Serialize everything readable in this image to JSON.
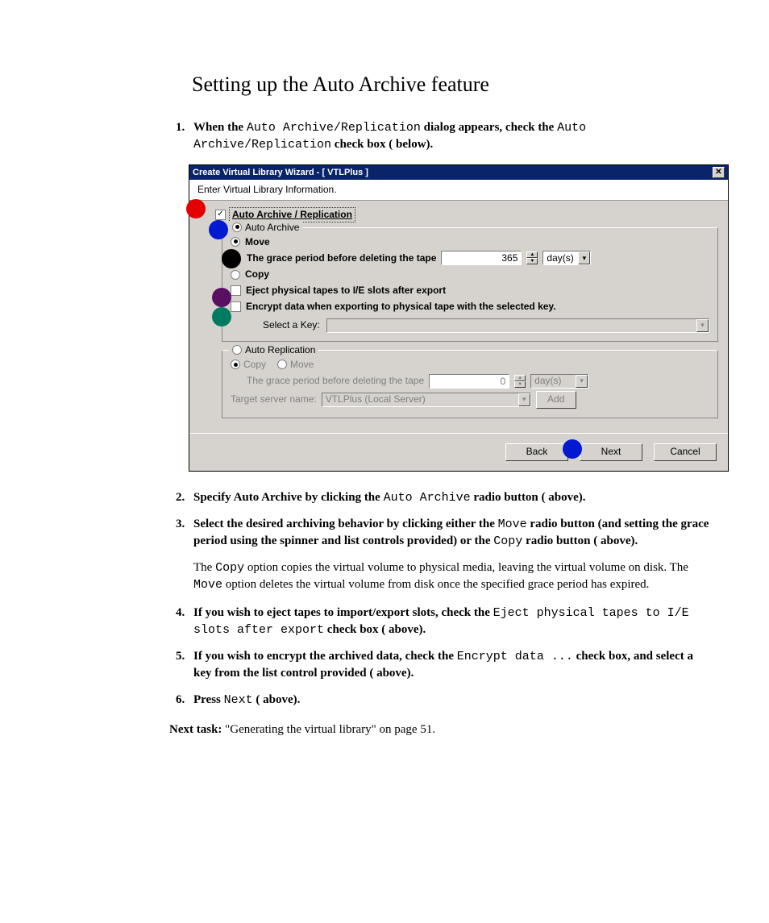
{
  "heading": "Setting up the Auto Archive feature",
  "step1": {
    "p1": "When the ",
    "mono1": "Auto Archive/Replication",
    "p2": " dialog appears, check the ",
    "mono2": "Auto Archive/Replication",
    "p3": " check box (   below)."
  },
  "dialog": {
    "title": "Create Virtual Library Wizard - [ VTLPlus ]",
    "info": "Enter Virtual Library Information.",
    "auto_arch_repl_label": "Auto Archive / Replication",
    "auto_arch_legend": "Auto Archive",
    "move_label": "Move",
    "grace_label": "The grace period before deleting the tape",
    "grace_value": "365",
    "grace_unit": "day(s)",
    "copy_label": "Copy",
    "eject_label": "Eject physical tapes to I/E slots after export",
    "encrypt_label": "Encrypt data when exporting to physical tape with the selected key.",
    "select_key_label": "Select a Key:",
    "auto_repl_legend": "Auto Replication",
    "repl_copy": "Copy",
    "repl_move": "Move",
    "repl_grace_label": "The grace period before deleting the tape",
    "repl_grace_value": "0",
    "repl_grace_unit": "day(s)",
    "target_label": "Target server name:",
    "target_value": "VTLPlus (Local Server)",
    "add_btn": "Add",
    "back": "Back",
    "next": "Next",
    "cancel": "Cancel"
  },
  "step2": {
    "p1": "Specify Auto Archive by clicking the ",
    "mono1": "Auto Archive",
    "p2": " radio button (   above)."
  },
  "step3": {
    "p1": "Select the desired archiving behavior by clicking either the ",
    "mono1": "Move",
    "p2": " radio button (and setting the grace period using the spinner and list controls provided) or the ",
    "mono2": "Copy",
    "p3": " radio button (   above)."
  },
  "para3": {
    "p1": "The ",
    "mono1": "Copy",
    "p2": " option copies the virtual volume to physical media, leaving the virtual volume on disk. The ",
    "mono2": "Move",
    "p3": " option deletes the virtual volume from disk once the specified grace period has expired."
  },
  "step4": {
    "p1": "If you wish to eject tapes to import/export slots, check the ",
    "mono1": "Eject physical tapes to I/E slots after export",
    "p2": " check box (   above)."
  },
  "step5": {
    "p1": "If you wish to encrypt the archived data, check the ",
    "mono1": "Encrypt data ...",
    "p2": " check box, and select a key from the list control provided (   above)."
  },
  "step6": {
    "p1": "Press ",
    "mono1": "Next",
    "p2": " (   above)."
  },
  "next_task": {
    "label": "Next task:",
    "text": "  \"Generating the virtual library\" on page 51."
  }
}
